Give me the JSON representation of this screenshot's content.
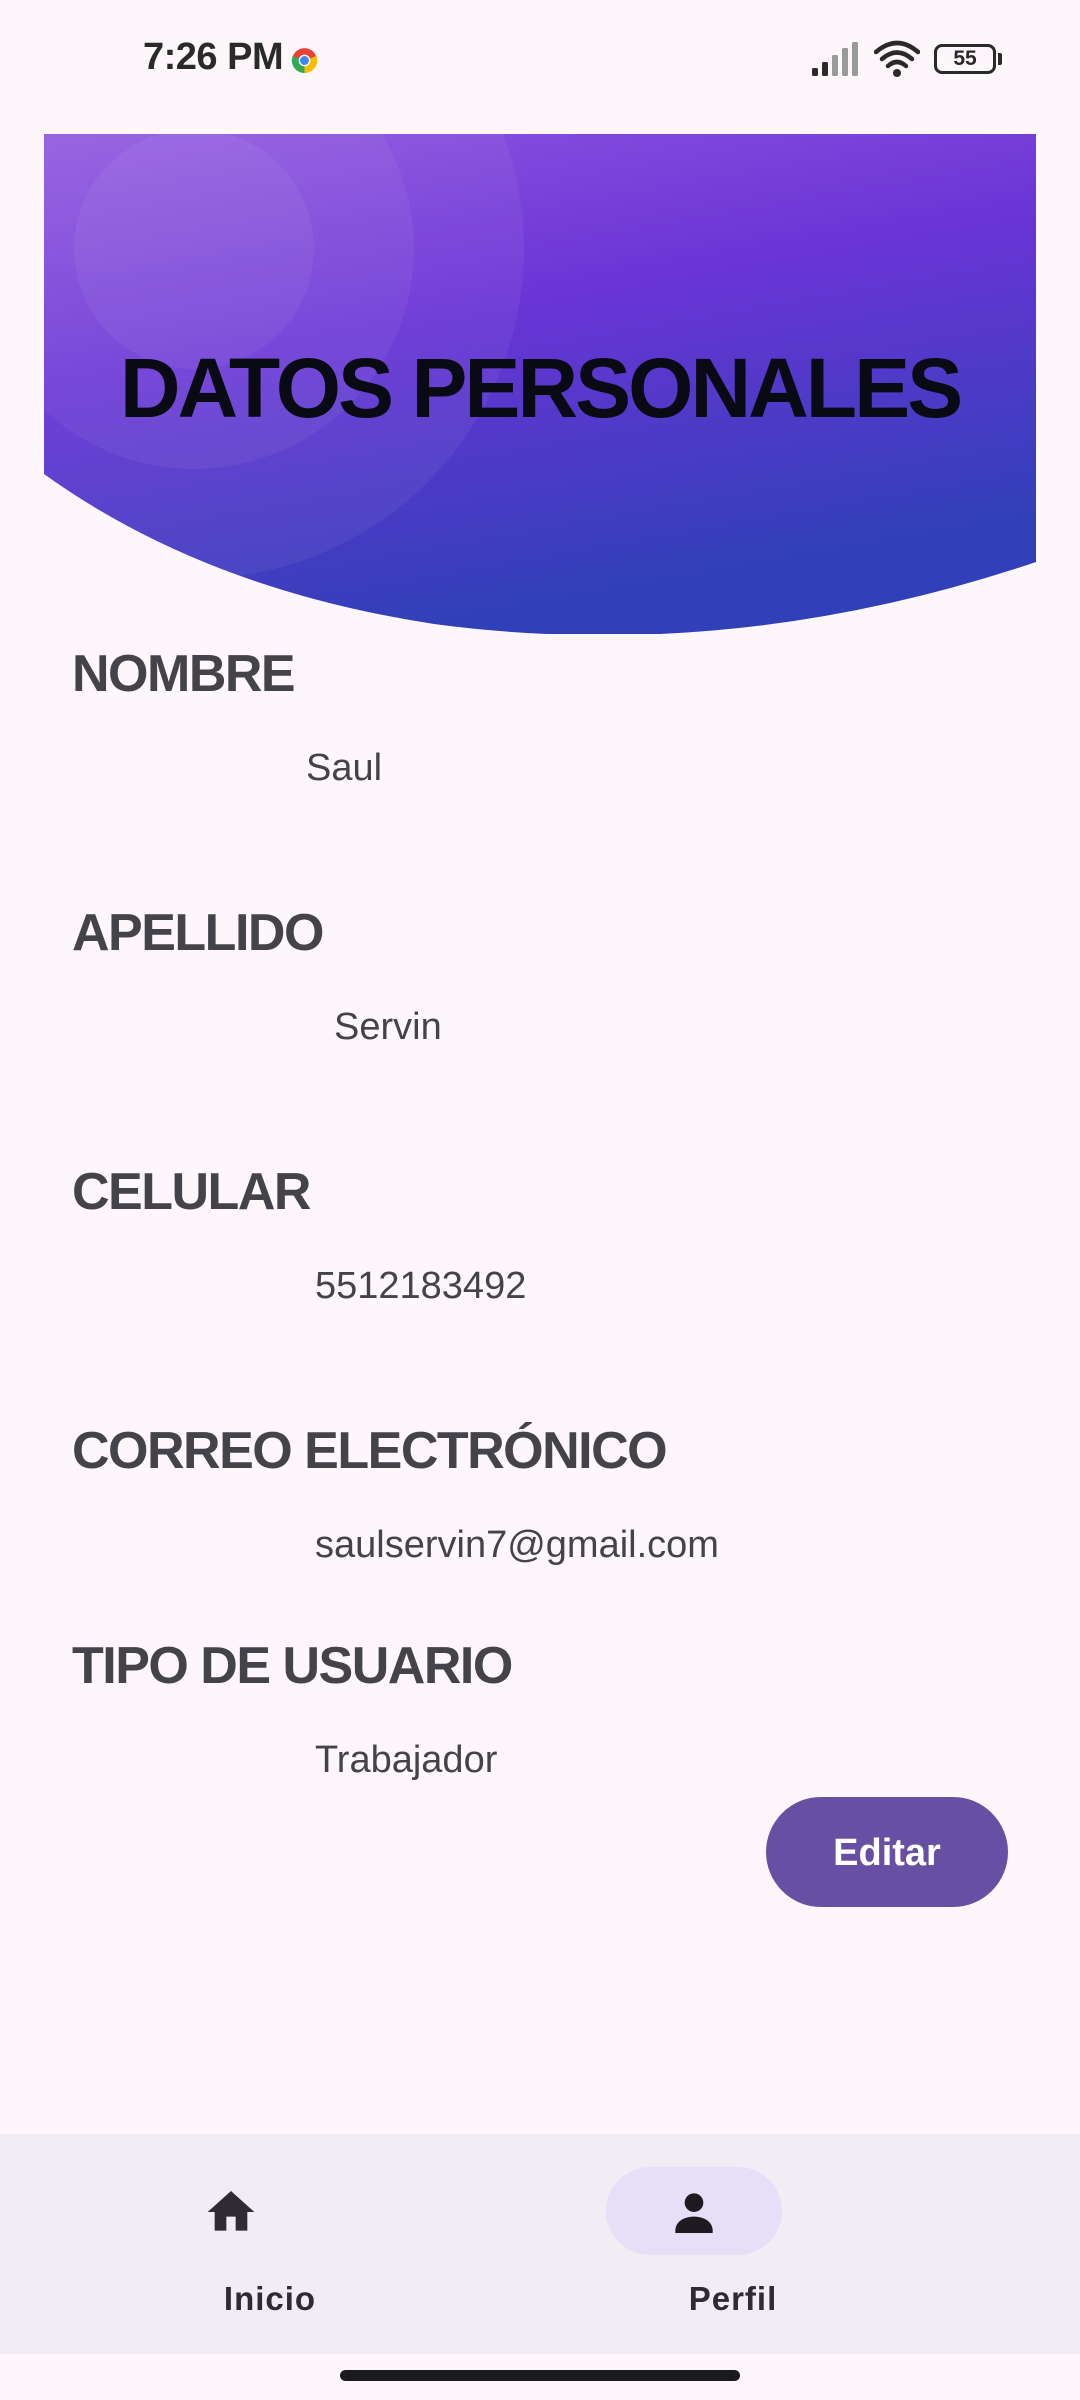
{
  "status_bar": {
    "time": "7:26 PM",
    "battery_level": "55",
    "icons": [
      "chrome-icon",
      "signal-icon",
      "wifi-icon",
      "battery-icon"
    ]
  },
  "header": {
    "title": "DATOS PERSONALES",
    "gradient_start": "#8f55e0",
    "gradient_end": "#3140b8"
  },
  "fields": {
    "nombre": {
      "label": "NOMBRE",
      "value": "Saul"
    },
    "apellido": {
      "label": "APELLIDO",
      "value": "Servin"
    },
    "celular": {
      "label": "CELULAR",
      "value": "5512183492"
    },
    "correo": {
      "label": "CORREO ELECTRÓNICO",
      "value": "saulservin7@gmail.com"
    },
    "tipo": {
      "label": "TIPO DE USUARIO",
      "value": "Trabajador"
    }
  },
  "actions": {
    "edit_label": "Editar",
    "edit_color": "#6750a4"
  },
  "bottom_nav": {
    "items": [
      {
        "label": "Inicio",
        "icon": "home-icon",
        "active": false
      },
      {
        "label": "Perfil",
        "icon": "person-icon",
        "active": true
      }
    ]
  }
}
